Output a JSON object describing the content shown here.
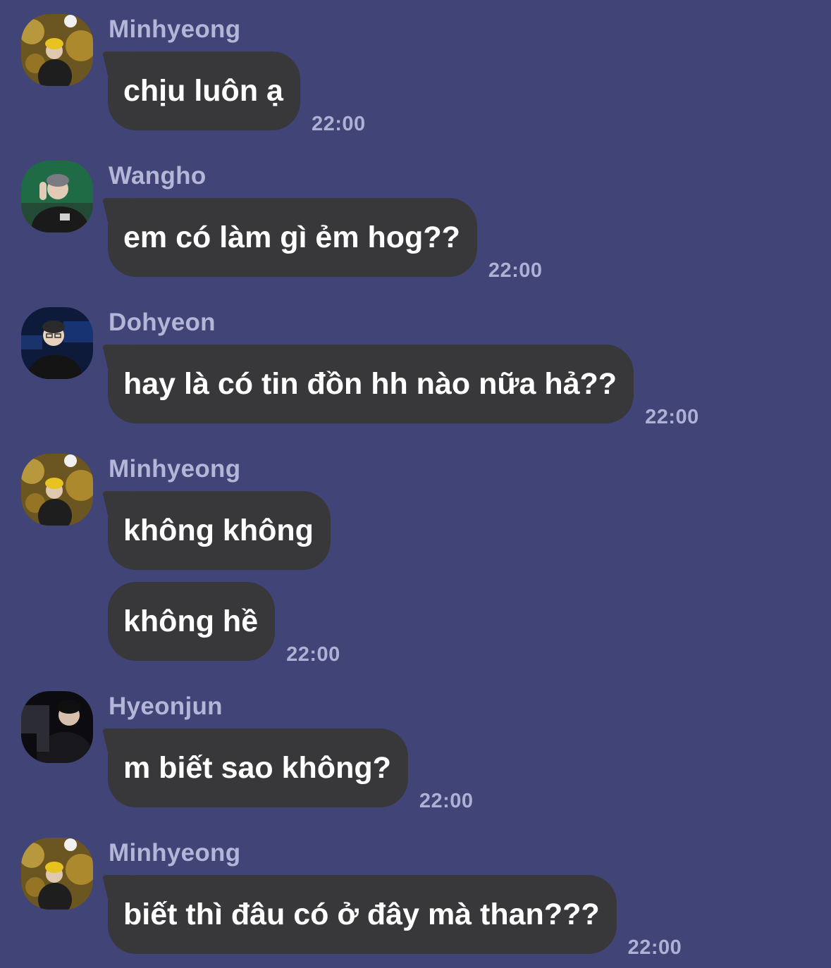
{
  "colors": {
    "background": "#414476",
    "bubble": "#38383a",
    "sender_name": "#b3b6d6",
    "timestamp": "#aeb1d3",
    "message_text": "#ffffff"
  },
  "messages": [
    {
      "sender": "Minhyeong",
      "avatar": "avatar-minhyeong-icon",
      "texts": [
        "chịu luôn ạ"
      ],
      "time": "22:00"
    },
    {
      "sender": "Wangho",
      "avatar": "avatar-wangho-icon",
      "texts": [
        "em có làm gì ẻm hog??"
      ],
      "time": "22:00"
    },
    {
      "sender": "Dohyeon",
      "avatar": "avatar-dohyeon-icon",
      "texts": [
        "hay là có tin đồn hh nào nữa hả??"
      ],
      "time": "22:00"
    },
    {
      "sender": "Minhyeong",
      "avatar": "avatar-minhyeong-icon",
      "texts": [
        "không không",
        "không hề"
      ],
      "time": "22:00"
    },
    {
      "sender": "Hyeonjun",
      "avatar": "avatar-hyeonjun-icon",
      "texts": [
        "m biết sao không?"
      ],
      "time": "22:00"
    },
    {
      "sender": "Minhyeong",
      "avatar": "avatar-minhyeong-icon",
      "texts": [
        "biết thì đâu có ở đây mà than???"
      ],
      "time": "22:00"
    }
  ]
}
